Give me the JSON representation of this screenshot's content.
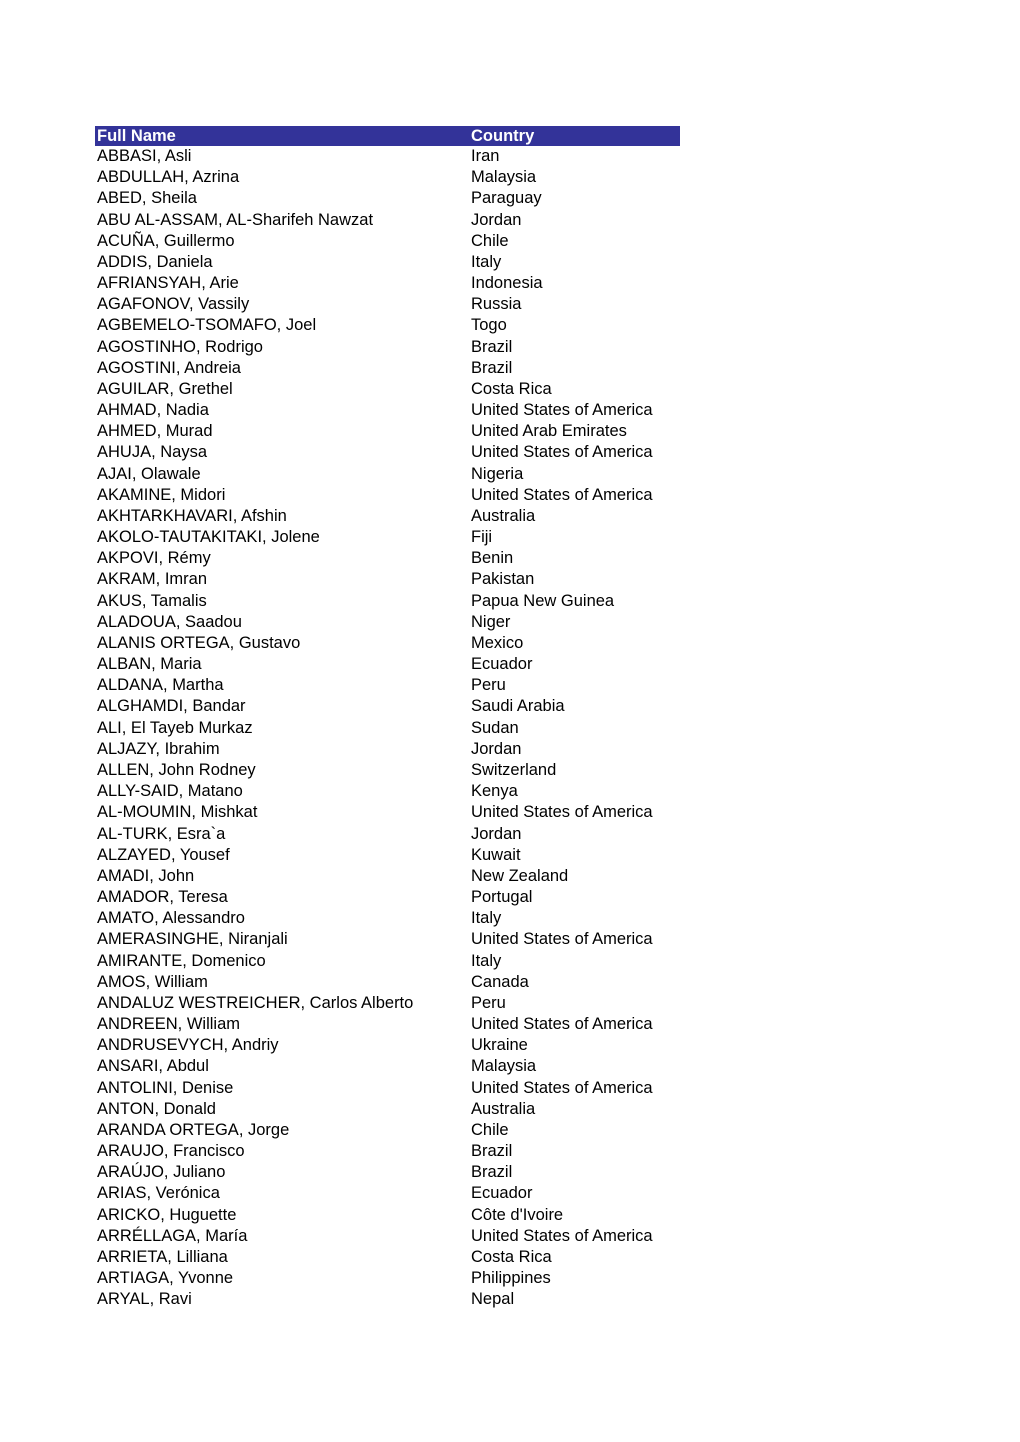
{
  "table": {
    "header_color": "#333399",
    "columns": [
      "Full Name",
      "Country"
    ],
    "rows": [
      [
        "ABBASI, Asli",
        "Iran"
      ],
      [
        "ABDULLAH, Azrina",
        "Malaysia"
      ],
      [
        "ABED, Sheila",
        "Paraguay"
      ],
      [
        "ABU AL-ASSAM, AL-Sharifeh Nawzat",
        "Jordan"
      ],
      [
        "ACUÑA, Guillermo",
        "Chile"
      ],
      [
        "ADDIS, Daniela",
        "Italy"
      ],
      [
        "AFRIANSYAH, Arie",
        "Indonesia"
      ],
      [
        "AGAFONOV, Vassily",
        "Russia"
      ],
      [
        "AGBEMELO-TSOMAFO, Joel",
        "Togo"
      ],
      [
        "AGOSTINHO, Rodrigo",
        "Brazil"
      ],
      [
        "AGOSTINI, Andreia",
        "Brazil"
      ],
      [
        "AGUILAR, Grethel",
        "Costa Rica"
      ],
      [
        "AHMAD, Nadia",
        "United States of America"
      ],
      [
        "AHMED, Murad",
        "United Arab Emirates"
      ],
      [
        "AHUJA, Naysa",
        "United States of America"
      ],
      [
        "AJAI, Olawale",
        "Nigeria"
      ],
      [
        "AKAMINE, Midori",
        "United States of America"
      ],
      [
        "AKHTARKHAVARI, Afshin",
        "Australia"
      ],
      [
        "AKOLO-TAUTAKITAKI, Jolene",
        "Fiji"
      ],
      [
        "AKPOVI, Rémy",
        "Benin"
      ],
      [
        "AKRAM, Imran",
        "Pakistan"
      ],
      [
        "AKUS, Tamalis",
        "Papua New Guinea"
      ],
      [
        "ALADOUA, Saadou",
        "Niger"
      ],
      [
        "ALANIS ORTEGA, Gustavo",
        "Mexico"
      ],
      [
        "ALBAN, Maria",
        "Ecuador"
      ],
      [
        "ALDANA, Martha",
        "Peru"
      ],
      [
        "ALGHAMDI, Bandar",
        "Saudi Arabia"
      ],
      [
        "ALI, El Tayeb Murkaz",
        "Sudan"
      ],
      [
        "ALJAZY, Ibrahim",
        "Jordan"
      ],
      [
        "ALLEN, John Rodney",
        "Switzerland"
      ],
      [
        "ALLY-SAID, Matano",
        "Kenya"
      ],
      [
        "AL-MOUMIN, Mishkat",
        "United States of America"
      ],
      [
        "AL-TURK, Esra`a",
        "Jordan"
      ],
      [
        "ALZAYED, Yousef",
        "Kuwait"
      ],
      [
        "AMADI, John",
        "New Zealand"
      ],
      [
        "AMADOR, Teresa",
        "Portugal"
      ],
      [
        "AMATO, Alessandro",
        "Italy"
      ],
      [
        "AMERASINGHE, Niranjali",
        "United States of America"
      ],
      [
        "AMIRANTE, Domenico",
        "Italy"
      ],
      [
        "AMOS, William",
        "Canada"
      ],
      [
        "ANDALUZ WESTREICHER, Carlos Alberto",
        "Peru"
      ],
      [
        "ANDREEN, William",
        "United States of America"
      ],
      [
        "ANDRUSEVYCH, Andriy",
        "Ukraine"
      ],
      [
        "ANSARI, Abdul",
        "Malaysia"
      ],
      [
        "ANTOLINI, Denise",
        "United States of America"
      ],
      [
        "ANTON, Donald",
        "Australia"
      ],
      [
        "ARANDA ORTEGA, Jorge",
        "Chile"
      ],
      [
        "ARAUJO, Francisco",
        "Brazil"
      ],
      [
        "ARAÚJO, Juliano",
        "Brazil"
      ],
      [
        "ARIAS, Verónica",
        "Ecuador"
      ],
      [
        "ARICKO, Huguette",
        "Côte d'Ivoire"
      ],
      [
        "ARRÉLLAGA, María",
        "United States of America"
      ],
      [
        "ARRIETA, Lilliana",
        "Costa Rica"
      ],
      [
        "ARTIAGA, Yvonne",
        "Philippines"
      ],
      [
        "ARYAL, Ravi",
        "Nepal"
      ]
    ]
  }
}
